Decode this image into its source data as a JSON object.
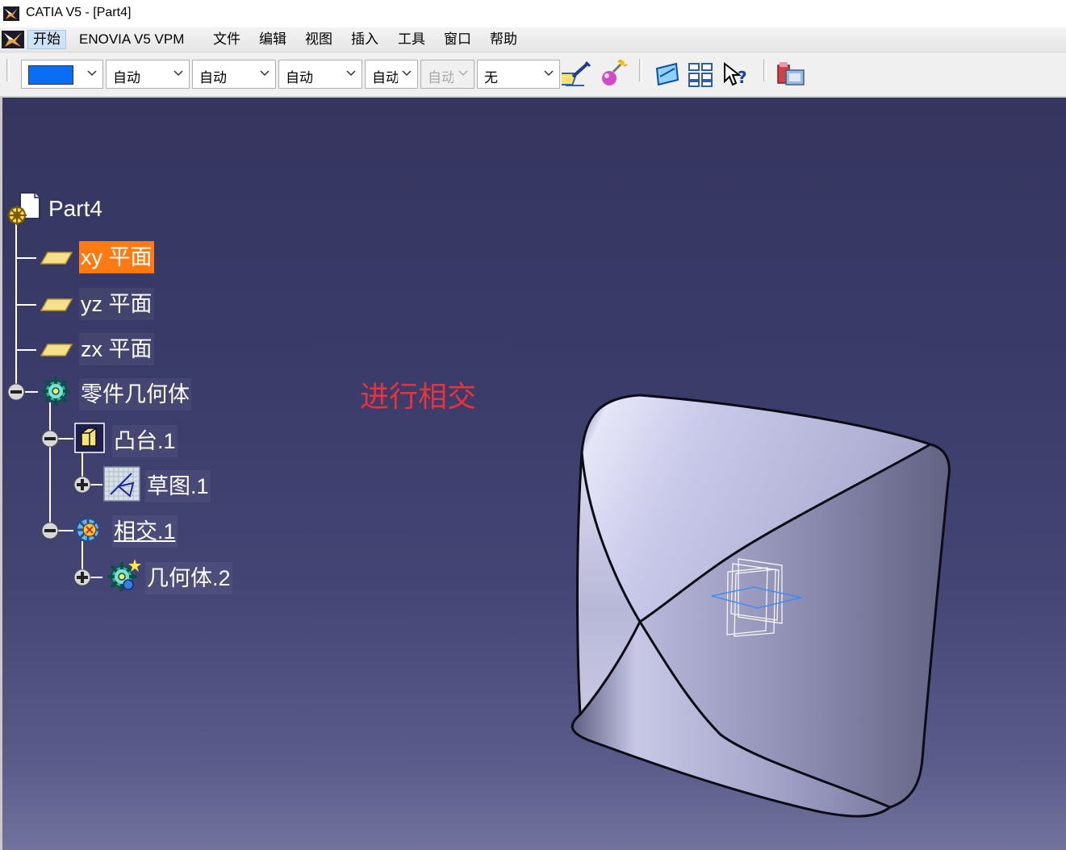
{
  "window": {
    "title": "CATIA V5 - [Part4]",
    "app_icon": "catia-logo-icon"
  },
  "menu": {
    "items": [
      {
        "label": "开始",
        "active": true
      },
      {
        "label": "ENOVIA V5 VPM"
      },
      {
        "label": "文件"
      },
      {
        "label": "编辑"
      },
      {
        "label": "视图"
      },
      {
        "label": "插入"
      },
      {
        "label": "工具"
      },
      {
        "label": "窗口"
      },
      {
        "label": "帮助"
      }
    ]
  },
  "toolbar": {
    "color_value": "#0a6ef5",
    "combo_linetype": "自动",
    "combo_thickness": "自动",
    "combo_point": "自动",
    "combo_layer": "自动",
    "combo_disabled": "自动",
    "combo_pattern": "无",
    "icons": [
      "painter-brush-icon",
      "graphic-properties-icon",
      "sketch-tool-icon",
      "multi-select-icon",
      "whats-this-icon",
      "catalog-icon"
    ]
  },
  "tree": {
    "root": "Part4",
    "planes": [
      "xy 平面",
      "yz 平面",
      "zx 平面"
    ],
    "body": "零件几何体",
    "pad": "凸台.1",
    "sketch": "草图.1",
    "intersect": "相交.1",
    "body2": "几何体.2"
  },
  "annotation": "进行相交",
  "colors": {
    "selection": "#ff7a12",
    "annotation": "#e8323c",
    "viewport_top": "#35355f",
    "viewport_bottom": "#72729d"
  }
}
